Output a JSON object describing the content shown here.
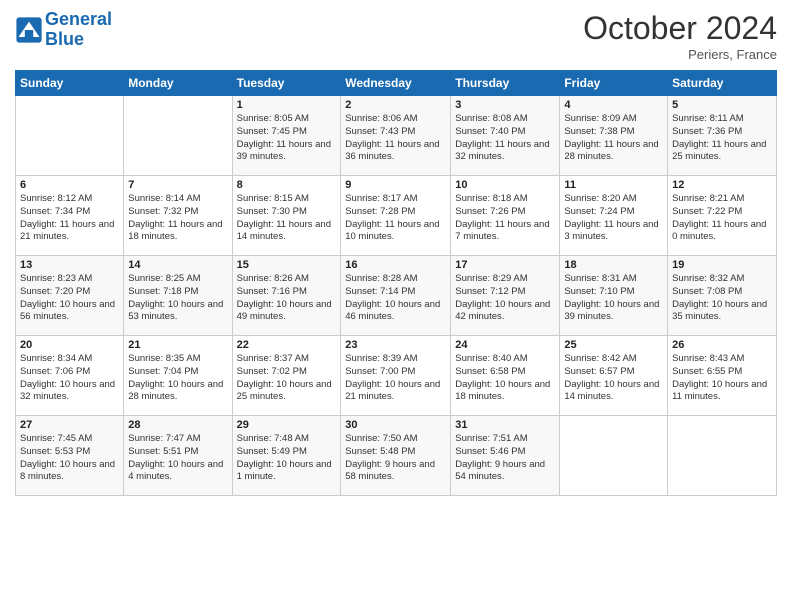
{
  "header": {
    "logo_line1": "General",
    "logo_line2": "Blue",
    "month_title": "October 2024",
    "subtitle": "Periers, France"
  },
  "days_of_week": [
    "Sunday",
    "Monday",
    "Tuesday",
    "Wednesday",
    "Thursday",
    "Friday",
    "Saturday"
  ],
  "weeks": [
    [
      {
        "day": "",
        "sunrise": "",
        "sunset": "",
        "daylight": ""
      },
      {
        "day": "",
        "sunrise": "",
        "sunset": "",
        "daylight": ""
      },
      {
        "day": "1",
        "sunrise": "Sunrise: 8:05 AM",
        "sunset": "Sunset: 7:45 PM",
        "daylight": "Daylight: 11 hours and 39 minutes."
      },
      {
        "day": "2",
        "sunrise": "Sunrise: 8:06 AM",
        "sunset": "Sunset: 7:43 PM",
        "daylight": "Daylight: 11 hours and 36 minutes."
      },
      {
        "day": "3",
        "sunrise": "Sunrise: 8:08 AM",
        "sunset": "Sunset: 7:40 PM",
        "daylight": "Daylight: 11 hours and 32 minutes."
      },
      {
        "day": "4",
        "sunrise": "Sunrise: 8:09 AM",
        "sunset": "Sunset: 7:38 PM",
        "daylight": "Daylight: 11 hours and 28 minutes."
      },
      {
        "day": "5",
        "sunrise": "Sunrise: 8:11 AM",
        "sunset": "Sunset: 7:36 PM",
        "daylight": "Daylight: 11 hours and 25 minutes."
      }
    ],
    [
      {
        "day": "6",
        "sunrise": "Sunrise: 8:12 AM",
        "sunset": "Sunset: 7:34 PM",
        "daylight": "Daylight: 11 hours and 21 minutes."
      },
      {
        "day": "7",
        "sunrise": "Sunrise: 8:14 AM",
        "sunset": "Sunset: 7:32 PM",
        "daylight": "Daylight: 11 hours and 18 minutes."
      },
      {
        "day": "8",
        "sunrise": "Sunrise: 8:15 AM",
        "sunset": "Sunset: 7:30 PM",
        "daylight": "Daylight: 11 hours and 14 minutes."
      },
      {
        "day": "9",
        "sunrise": "Sunrise: 8:17 AM",
        "sunset": "Sunset: 7:28 PM",
        "daylight": "Daylight: 11 hours and 10 minutes."
      },
      {
        "day": "10",
        "sunrise": "Sunrise: 8:18 AM",
        "sunset": "Sunset: 7:26 PM",
        "daylight": "Daylight: 11 hours and 7 minutes."
      },
      {
        "day": "11",
        "sunrise": "Sunrise: 8:20 AM",
        "sunset": "Sunset: 7:24 PM",
        "daylight": "Daylight: 11 hours and 3 minutes."
      },
      {
        "day": "12",
        "sunrise": "Sunrise: 8:21 AM",
        "sunset": "Sunset: 7:22 PM",
        "daylight": "Daylight: 11 hours and 0 minutes."
      }
    ],
    [
      {
        "day": "13",
        "sunrise": "Sunrise: 8:23 AM",
        "sunset": "Sunset: 7:20 PM",
        "daylight": "Daylight: 10 hours and 56 minutes."
      },
      {
        "day": "14",
        "sunrise": "Sunrise: 8:25 AM",
        "sunset": "Sunset: 7:18 PM",
        "daylight": "Daylight: 10 hours and 53 minutes."
      },
      {
        "day": "15",
        "sunrise": "Sunrise: 8:26 AM",
        "sunset": "Sunset: 7:16 PM",
        "daylight": "Daylight: 10 hours and 49 minutes."
      },
      {
        "day": "16",
        "sunrise": "Sunrise: 8:28 AM",
        "sunset": "Sunset: 7:14 PM",
        "daylight": "Daylight: 10 hours and 46 minutes."
      },
      {
        "day": "17",
        "sunrise": "Sunrise: 8:29 AM",
        "sunset": "Sunset: 7:12 PM",
        "daylight": "Daylight: 10 hours and 42 minutes."
      },
      {
        "day": "18",
        "sunrise": "Sunrise: 8:31 AM",
        "sunset": "Sunset: 7:10 PM",
        "daylight": "Daylight: 10 hours and 39 minutes."
      },
      {
        "day": "19",
        "sunrise": "Sunrise: 8:32 AM",
        "sunset": "Sunset: 7:08 PM",
        "daylight": "Daylight: 10 hours and 35 minutes."
      }
    ],
    [
      {
        "day": "20",
        "sunrise": "Sunrise: 8:34 AM",
        "sunset": "Sunset: 7:06 PM",
        "daylight": "Daylight: 10 hours and 32 minutes."
      },
      {
        "day": "21",
        "sunrise": "Sunrise: 8:35 AM",
        "sunset": "Sunset: 7:04 PM",
        "daylight": "Daylight: 10 hours and 28 minutes."
      },
      {
        "day": "22",
        "sunrise": "Sunrise: 8:37 AM",
        "sunset": "Sunset: 7:02 PM",
        "daylight": "Daylight: 10 hours and 25 minutes."
      },
      {
        "day": "23",
        "sunrise": "Sunrise: 8:39 AM",
        "sunset": "Sunset: 7:00 PM",
        "daylight": "Daylight: 10 hours and 21 minutes."
      },
      {
        "day": "24",
        "sunrise": "Sunrise: 8:40 AM",
        "sunset": "Sunset: 6:58 PM",
        "daylight": "Daylight: 10 hours and 18 minutes."
      },
      {
        "day": "25",
        "sunrise": "Sunrise: 8:42 AM",
        "sunset": "Sunset: 6:57 PM",
        "daylight": "Daylight: 10 hours and 14 minutes."
      },
      {
        "day": "26",
        "sunrise": "Sunrise: 8:43 AM",
        "sunset": "Sunset: 6:55 PM",
        "daylight": "Daylight: 10 hours and 11 minutes."
      }
    ],
    [
      {
        "day": "27",
        "sunrise": "Sunrise: 7:45 AM",
        "sunset": "Sunset: 5:53 PM",
        "daylight": "Daylight: 10 hours and 8 minutes."
      },
      {
        "day": "28",
        "sunrise": "Sunrise: 7:47 AM",
        "sunset": "Sunset: 5:51 PM",
        "daylight": "Daylight: 10 hours and 4 minutes."
      },
      {
        "day": "29",
        "sunrise": "Sunrise: 7:48 AM",
        "sunset": "Sunset: 5:49 PM",
        "daylight": "Daylight: 10 hours and 1 minute."
      },
      {
        "day": "30",
        "sunrise": "Sunrise: 7:50 AM",
        "sunset": "Sunset: 5:48 PM",
        "daylight": "Daylight: 9 hours and 58 minutes."
      },
      {
        "day": "31",
        "sunrise": "Sunrise: 7:51 AM",
        "sunset": "Sunset: 5:46 PM",
        "daylight": "Daylight: 9 hours and 54 minutes."
      },
      {
        "day": "",
        "sunrise": "",
        "sunset": "",
        "daylight": ""
      },
      {
        "day": "",
        "sunrise": "",
        "sunset": "",
        "daylight": ""
      }
    ]
  ]
}
